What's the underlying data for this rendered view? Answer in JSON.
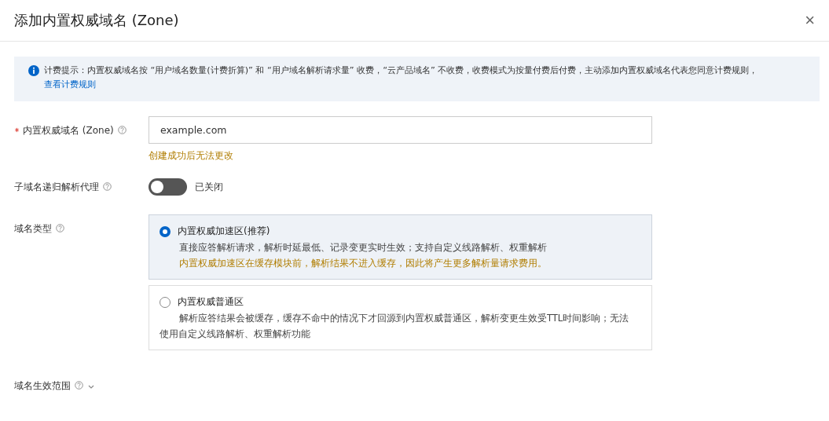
{
  "dialog": {
    "title": "添加内置权威域名 (Zone)",
    "close": "×"
  },
  "notice": {
    "text": "计费提示：内置权威域名按 “用户域名数量(计费折算)” 和 “用户域名解析请求量” 收费，“云产品域名” 不收费，收费模式为按量付费后付费，主动添加内置权威域名代表您同意计费规则，",
    "link": "查看计费规则"
  },
  "zone_field": {
    "label": "内置权威域名 (Zone)",
    "required": true,
    "value": "example.com",
    "hint": "创建成功后无法更改"
  },
  "recursion": {
    "label": "子域名递归解析代理",
    "on": false,
    "status": "已关闭"
  },
  "domain_type": {
    "label": "域名类型",
    "options": [
      {
        "title": "内置权威加速区(推荐)",
        "selected": true,
        "lines": [
          {
            "text": "直接应答解析请求，解析时延最低、记录变更实时生效；支持自定义线路解析、权重解析",
            "kind": "normal"
          },
          {
            "text": "内置权威加速区在缓存模块前，解析结果不进入缓存，因此将产生更多解析量请求费用。",
            "kind": "warning"
          }
        ]
      },
      {
        "title": "内置权威普通区",
        "selected": false,
        "lines": [
          {
            "text": "解析应答结果会被缓存，缓存不命中的情况下才回源到内置权威普通区，解析变更生效受TTL时间影响；无法使用自定义线路解析、权重解析功能",
            "kind": "normal"
          }
        ]
      }
    ]
  },
  "scope": {
    "label": "域名生效范围",
    "expanded": false
  }
}
